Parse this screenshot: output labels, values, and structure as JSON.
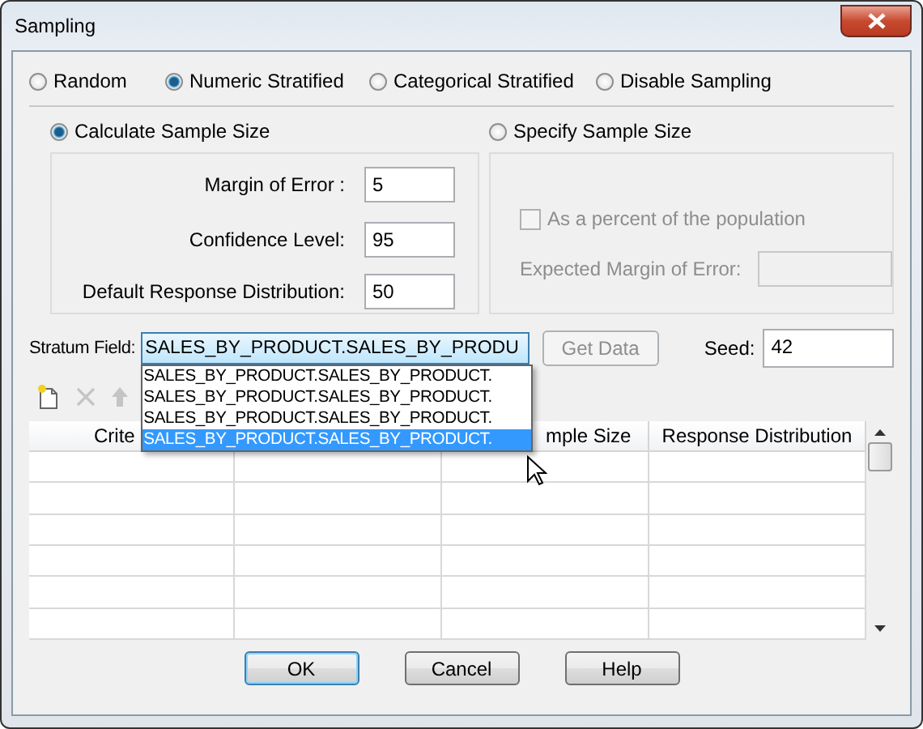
{
  "window": {
    "title": "Sampling"
  },
  "sampling_methods": [
    {
      "label": "Random",
      "selected": false
    },
    {
      "label": "Numeric Stratified",
      "selected": true
    },
    {
      "label": "Categorical Stratified",
      "selected": false
    },
    {
      "label": "Disable Sampling",
      "selected": false
    }
  ],
  "sample_size_modes": [
    {
      "label": "Calculate Sample Size",
      "selected": true
    },
    {
      "label": "Specify Sample Size",
      "selected": false
    }
  ],
  "calculate": {
    "fields": [
      {
        "label": "Margin of Error :",
        "value": "5"
      },
      {
        "label": "Confidence Level:",
        "value": "95"
      },
      {
        "label": "Default Response Distribution:",
        "value": "50"
      }
    ]
  },
  "specify": {
    "disabled": true,
    "percent_checkbox": {
      "label": "As a percent of the population",
      "checked": false
    },
    "expected_margin": {
      "label": "Expected Margin of Error:"
    }
  },
  "stratum": {
    "label": "Stratum Field:",
    "value": "SALES_BY_PRODUCT.SALES_BY_PRODU",
    "expanded": true,
    "options": [
      {
        "label": "SALES_BY_PRODUCT.SALES_BY_PRODUCT.",
        "selected": false
      },
      {
        "label": "SALES_BY_PRODUCT.SALES_BY_PRODUCT.",
        "selected": false
      },
      {
        "label": "SALES_BY_PRODUCT.SALES_BY_PRODUCT.",
        "selected": false
      },
      {
        "label": "SALES_BY_PRODUCT.SALES_BY_PRODUCT.",
        "selected": true
      }
    ]
  },
  "get_data": {
    "label": "Get Data",
    "disabled": true
  },
  "seed": {
    "label": "Seed:",
    "value": "42"
  },
  "toolbar": [
    {
      "kind": "new",
      "disabled": false
    },
    {
      "kind": "delete",
      "disabled": true
    },
    {
      "kind": "up",
      "disabled": true
    }
  ],
  "table": {
    "column_1": "Crite",
    "column_3": "mple Size",
    "column_4": "Response Distribution"
  },
  "buttons": [
    {
      "label": "OK",
      "default": true
    },
    {
      "label": "Cancel",
      "default": false
    },
    {
      "label": "Help",
      "default": false
    }
  ]
}
